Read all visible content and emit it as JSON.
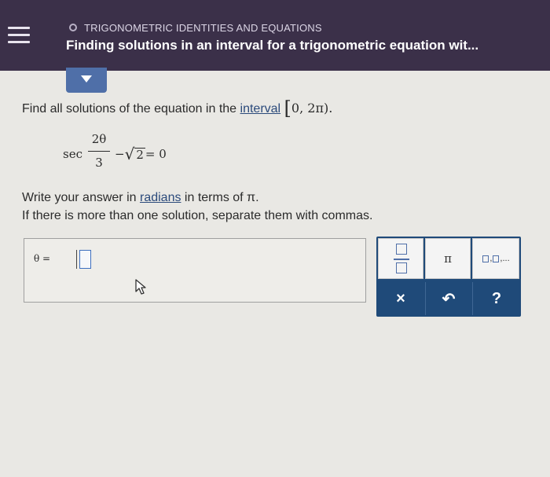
{
  "header": {
    "topic": "TRIGONOMETRIC IDENTITIES AND EQUATIONS",
    "title": "Finding solutions in an interval for a trigonometric equation wit..."
  },
  "question": {
    "prefix": "Find all solutions of the equation in the ",
    "interval_link": "interval",
    "interval_open": "[",
    "interval_body": "0, 2π).",
    "equation": {
      "func": "sec",
      "numerator": "2θ",
      "denominator": "3",
      "minus": "−",
      "sqrt_symbol": "√",
      "radicand": "2",
      "rhs": " = 0"
    },
    "instruction1_prefix": "Write your answer in ",
    "instruction1_link": "radians",
    "instruction1_suffix": " in terms of π.",
    "instruction2": "If there is more than one solution, separate them with commas."
  },
  "answer": {
    "label": "θ =",
    "value": ""
  },
  "keypad": {
    "pi": "π",
    "list_suffix": ",...",
    "clear": "×",
    "undo": "↶",
    "help": "?"
  },
  "colors": {
    "header_bg": "#3b3049",
    "accent": "#4f6fa8",
    "keypad_bg": "#1f4a79"
  }
}
